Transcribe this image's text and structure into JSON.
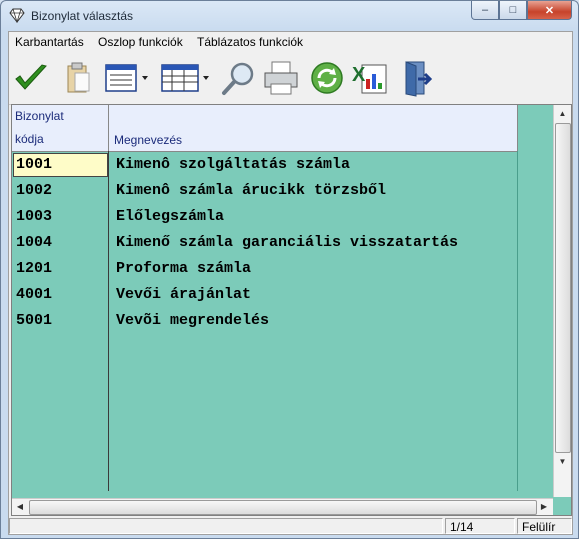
{
  "window": {
    "title": "Bizonylat választás",
    "min_label": "–",
    "max_label": "□",
    "close_label": "✕"
  },
  "menu": {
    "items": [
      "Karbantartás",
      "Oszlop funkciók",
      "Táblázatos funkciók"
    ]
  },
  "toolbar": {
    "icons": [
      "checkmark-icon",
      "clipboard-icon",
      "form-view-icon",
      "table-view-icon",
      "search-icon",
      "printer-icon",
      "refresh-icon",
      "excel-export-icon",
      "exit-door-icon"
    ]
  },
  "table": {
    "columns": [
      "Bizonylat\nkódja",
      "Megnevezés"
    ],
    "col1_line1": "Bizonylat",
    "col1_line2": "kódja",
    "col2": "Megnevezés",
    "rows": [
      {
        "code": "1001",
        "name": "Kimenô szolgáltatás számla"
      },
      {
        "code": "1002",
        "name": "Kimenô számla árucikk törzsből"
      },
      {
        "code": "1003",
        "name": "Előlegszámla"
      },
      {
        "code": "1004",
        "name": "Kimenő számla garanciális visszatartás"
      },
      {
        "code": "1201",
        "name": "Proforma számla"
      },
      {
        "code": "4001",
        "name": "Vevői árajánlat"
      },
      {
        "code": "5001",
        "name": "Vevõi megrendelés"
      }
    ],
    "selected_row": 0
  },
  "status": {
    "position": "1/14",
    "mode": "Felülír"
  },
  "colors": {
    "grid_bg": "#7ccbb9",
    "header_bg": "#e8eefc",
    "selected_cell": "#fefcc8"
  }
}
